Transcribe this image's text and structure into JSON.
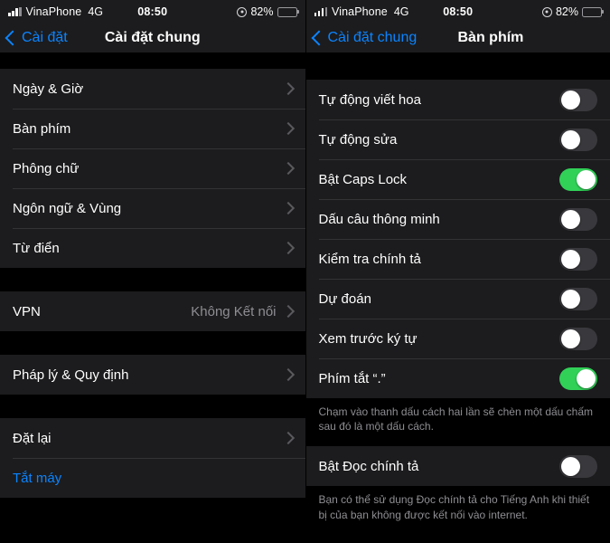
{
  "colors": {
    "accent_blue": "#0a84ff",
    "toggle_on_green": "#31d158",
    "toggle_off_gray": "#39393d",
    "row_background": "#1c1c1e",
    "page_background": "#000000",
    "secondary_text": "#8e8e93"
  },
  "left_screen": {
    "status_bar": {
      "signal_icon": "signal-bars-icon",
      "carrier": "VinaPhone",
      "network": "4G",
      "time": "08:50",
      "location_icon": "location-services-icon",
      "battery_percent": "82%",
      "battery_icon": "battery-icon"
    },
    "nav": {
      "back_icon": "chevron-left-icon",
      "back_label": "Cài đặt",
      "title": "Cài đặt chung"
    },
    "groups": [
      {
        "rows": [
          {
            "label": "Ngày & Giờ",
            "accessory": "chevron"
          },
          {
            "label": "Bàn phím",
            "accessory": "chevron"
          },
          {
            "label": "Phông chữ",
            "accessory": "chevron"
          },
          {
            "label": "Ngôn ngữ & Vùng",
            "accessory": "chevron"
          },
          {
            "label": "Từ điển",
            "accessory": "chevron"
          }
        ]
      },
      {
        "rows": [
          {
            "label": "VPN",
            "value": "Không Kết nối",
            "accessory": "chevron"
          }
        ]
      },
      {
        "rows": [
          {
            "label": "Pháp lý & Quy định",
            "accessory": "chevron"
          }
        ]
      },
      {
        "rows": [
          {
            "label": "Đặt lại",
            "accessory": "chevron"
          },
          {
            "label": "Tắt máy",
            "accessory": "none",
            "style": "blue"
          }
        ]
      }
    ]
  },
  "right_screen": {
    "status_bar": {
      "signal_icon": "signal-bars-icon",
      "carrier": "VinaPhone",
      "network": "4G",
      "time": "08:50",
      "location_icon": "location-services-icon",
      "battery_percent": "82%",
      "battery_icon": "battery-icon"
    },
    "nav": {
      "back_icon": "chevron-left-icon",
      "back_label": "Cài đặt chung",
      "title": "Bàn phím"
    },
    "toggles": [
      {
        "label": "Tự động viết hoa",
        "on": false
      },
      {
        "label": "Tự động sửa",
        "on": false
      },
      {
        "label": "Bật Caps Lock",
        "on": true
      },
      {
        "label": "Dấu câu thông minh",
        "on": false
      },
      {
        "label": "Kiểm tra chính tả",
        "on": false
      },
      {
        "label": "Dự đoán",
        "on": false
      },
      {
        "label": "Xem trước ký tự",
        "on": false
      },
      {
        "label": "Phím tắt “.”",
        "on": true
      }
    ],
    "footer_1": "Chạm vào thanh dấu cách hai lần sẽ chèn một dấu chấm sau đó là một dấu cách.",
    "dictation": {
      "label": "Bật Đọc chính tả",
      "on": false
    },
    "footer_2": "Bạn có thể sử dụng Đọc chính tả cho Tiếng Anh khi thiết bị của bạn không được kết nối vào internet."
  }
}
